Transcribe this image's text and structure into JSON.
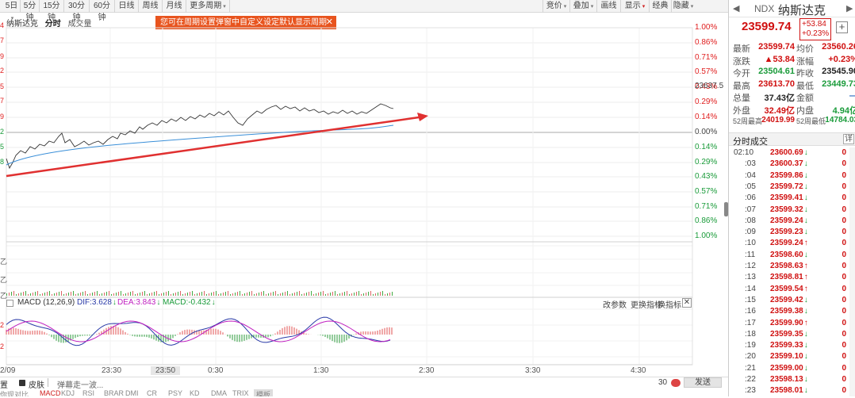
{
  "toolbar": {
    "left": [
      {
        "label": "5日",
        "dropdown": true
      },
      {
        "label": "5分钟",
        "dropdown": false
      },
      {
        "label": "15分钟",
        "dropdown": false
      },
      {
        "label": "30分钟",
        "dropdown": false
      },
      {
        "label": "60分钟",
        "dropdown": false
      },
      {
        "label": "日线",
        "dropdown": false
      },
      {
        "label": "周线",
        "dropdown": false
      },
      {
        "label": "月线",
        "dropdown": false
      },
      {
        "label": "更多周期",
        "dropdown": true
      }
    ],
    "right": [
      {
        "label": "竞价",
        "dropdown": true
      },
      {
        "label": "叠加",
        "dropdown": true
      },
      {
        "label": "画线",
        "dropdown": false
      },
      {
        "label": "显示",
        "dropdown": true
      },
      {
        "label": "经典",
        "dropdown": false
      },
      {
        "label": "隐藏",
        "dropdown": true
      }
    ]
  },
  "notice": {
    "text": "您可在周期设置弹窗中自定义设定默认显示周期啦！",
    "close": "✕"
  },
  "chart_header": {
    "name": "纳斯达克",
    "tab_active": "分时",
    "tab_other": "成交量"
  },
  "price_axis_left": [
    "4",
    "7",
    "9",
    "2",
    "5",
    "7",
    "9",
    "2",
    "5",
    "8"
  ],
  "pct_axis_right": [
    "1.00%",
    "0.86%",
    "0.71%",
    "0.57%",
    "0.43%",
    "0.29%",
    "0.14%",
    "0.00%",
    "0.14%",
    "0.29%",
    "0.43%",
    "0.57%",
    "0.71%",
    "0.86%",
    "1.00%"
  ],
  "crosshair_price": "23637.5",
  "volume_axis": [
    "乙",
    "乙",
    "乙"
  ],
  "macd": {
    "label": "MACD (12,26,9)",
    "dif": "DIF:3.628",
    "dea": "DEA:3.843",
    "macd": "MACD:-0.432",
    "change_params": "改参数",
    "change_indicator": "更换指标",
    "help": "换指标",
    "close": "✕",
    "left_ticks": [
      "2",
      "2"
    ]
  },
  "x_axis": {
    "left_edge": "2/09",
    "labels": [
      "23:30",
      "23:50",
      "0:30",
      "1:30",
      "2:30",
      "3:30",
      "4:30"
    ]
  },
  "bottom_bar": {
    "left1": "置",
    "skin_icon": "皮肤",
    "danmu": "弹幕走一波...",
    "count": "30",
    "send": "发送"
  },
  "bottom_tabs": [
    "你现对比",
    "MACD",
    "KDJ",
    "RSI",
    "BRAR",
    "DMI",
    "CR",
    "PSY",
    "KD",
    "DMA",
    "TRIX",
    "模板"
  ],
  "quote": {
    "code": "NDX",
    "name": "纳斯达克",
    "price": "23599.74",
    "change": "+53.84",
    "change_pct": "+0.23%",
    "add_btn": "+",
    "rows": [
      [
        {
          "k": "最新",
          "v": "23599.74",
          "c": "red"
        },
        {
          "k": "均价",
          "v": "23560.26",
          "c": "red"
        }
      ],
      [
        {
          "k": "涨跌",
          "v": "▲53.84",
          "c": "red"
        },
        {
          "k": "涨幅",
          "v": "+0.23%",
          "c": "red"
        }
      ],
      [
        {
          "k": "今开",
          "v": "23504.61",
          "c": "green"
        },
        {
          "k": "昨收",
          "v": "23545.90",
          "c": "black"
        }
      ],
      [
        {
          "k": "最高",
          "v": "23613.70",
          "c": "red"
        },
        {
          "k": "最低",
          "v": "23449.73",
          "c": "green"
        }
      ],
      [
        {
          "k": "总量",
          "v": "37.43亿",
          "c": "black"
        },
        {
          "k": "金额",
          "v": "—",
          "c": "blue"
        }
      ],
      [
        {
          "k": "外盘",
          "v": "32.49亿",
          "c": "red"
        },
        {
          "k": "内盘",
          "v": "4.94亿",
          "c": "green"
        }
      ],
      [
        {
          "k": "52周最高",
          "v": "24019.99",
          "c": "red"
        },
        {
          "k": "52周最低",
          "v": "14784.03",
          "c": "green"
        }
      ]
    ]
  },
  "ticks": {
    "title": "分时成交",
    "detail": "详",
    "rows": [
      {
        "t": "02:10",
        "p": "23600.69",
        "d": "down",
        "v": "0"
      },
      {
        "t": ":03",
        "p": "23600.37",
        "d": "down",
        "v": "0"
      },
      {
        "t": ":04",
        "p": "23599.86",
        "d": "down",
        "v": "0"
      },
      {
        "t": ":05",
        "p": "23599.72",
        "d": "down",
        "v": "0"
      },
      {
        "t": ":06",
        "p": "23599.41",
        "d": "down",
        "v": "0"
      },
      {
        "t": ":07",
        "p": "23599.32",
        "d": "down",
        "v": "0"
      },
      {
        "t": ":08",
        "p": "23599.24",
        "d": "down",
        "v": "0"
      },
      {
        "t": ":09",
        "p": "23599.23",
        "d": "down",
        "v": "0"
      },
      {
        "t": ":10",
        "p": "23599.24",
        "d": "up",
        "v": "0"
      },
      {
        "t": ":11",
        "p": "23598.60",
        "d": "down",
        "v": "0"
      },
      {
        "t": ":12",
        "p": "23598.63",
        "d": "up",
        "v": "0"
      },
      {
        "t": ":13",
        "p": "23598.81",
        "d": "up",
        "v": "0"
      },
      {
        "t": ":14",
        "p": "23599.54",
        "d": "up",
        "v": "0"
      },
      {
        "t": ":15",
        "p": "23599.42",
        "d": "down",
        "v": "0"
      },
      {
        "t": ":16",
        "p": "23599.38",
        "d": "down",
        "v": "0"
      },
      {
        "t": ":17",
        "p": "23599.90",
        "d": "up",
        "v": "0"
      },
      {
        "t": ":18",
        "p": "23599.35",
        "d": "down",
        "v": "0"
      },
      {
        "t": ":19",
        "p": "23599.33",
        "d": "down",
        "v": "0"
      },
      {
        "t": ":20",
        "p": "23599.10",
        "d": "down",
        "v": "0"
      },
      {
        "t": ":21",
        "p": "23599.00",
        "d": "down",
        "v": "0"
      },
      {
        "t": ":22",
        "p": "23598.13",
        "d": "down",
        "v": "0"
      },
      {
        "t": ":23",
        "p": "23598.01",
        "d": "down",
        "v": "0"
      }
    ]
  }
}
